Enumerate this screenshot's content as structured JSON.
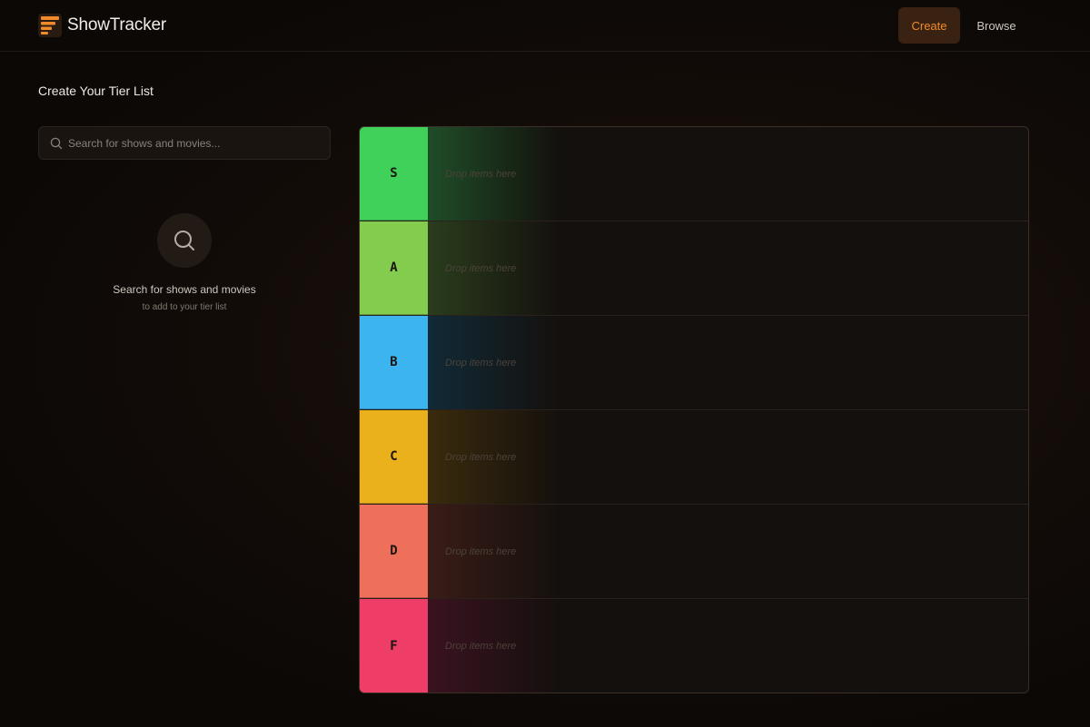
{
  "app": {
    "brand": "ShowTracker",
    "logo_icon": "stacked-bars-logo-icon",
    "accent": "#f08a2a"
  },
  "nav": {
    "create_label": "Create",
    "browse_label": "Browse"
  },
  "page": {
    "title": "Create Your Tier List"
  },
  "search": {
    "placeholder": "Search for shows and movies...",
    "value": "",
    "icon": "search-icon"
  },
  "empty_state": {
    "icon": "search-icon",
    "title": "Search for shows and movies",
    "subtitle": "to add to your tier list"
  },
  "tiers": [
    {
      "label": "S",
      "color": "#3fd159",
      "glow": "#1f4d28",
      "hint": "Drop items here"
    },
    {
      "label": "A",
      "color": "#84cc4e",
      "glow": "#2a3d1c",
      "hint": "Drop items here"
    },
    {
      "label": "B",
      "color": "#3cb4f0",
      "glow": "#112a37",
      "hint": "Drop items here"
    },
    {
      "label": "C",
      "color": "#ebb11d",
      "glow": "#3a2b0d",
      "hint": "Drop items here"
    },
    {
      "label": "D",
      "color": "#ee705a",
      "glow": "#3a1c17",
      "hint": "Drop items here"
    },
    {
      "label": "F",
      "color": "#ee3e68",
      "glow": "#3a1220",
      "hint": "Drop items here"
    }
  ]
}
